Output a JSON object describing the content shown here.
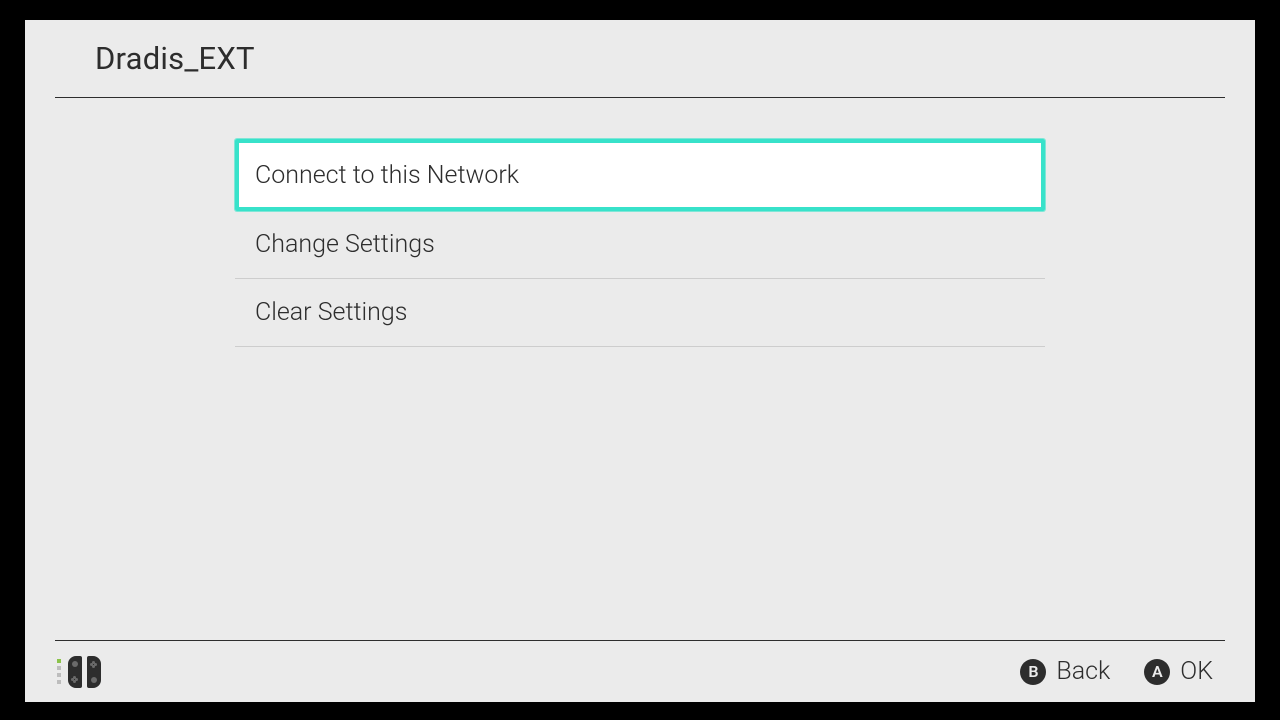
{
  "header": {
    "title": "Dradis_EXT"
  },
  "menu": {
    "items": [
      {
        "label": "Connect to this Network",
        "selected": true
      },
      {
        "label": "Change Settings",
        "selected": false
      },
      {
        "label": "Clear Settings",
        "selected": false
      }
    ]
  },
  "footer": {
    "actions": [
      {
        "glyph": "B",
        "label": "Back"
      },
      {
        "glyph": "A",
        "label": "OK"
      }
    ]
  }
}
